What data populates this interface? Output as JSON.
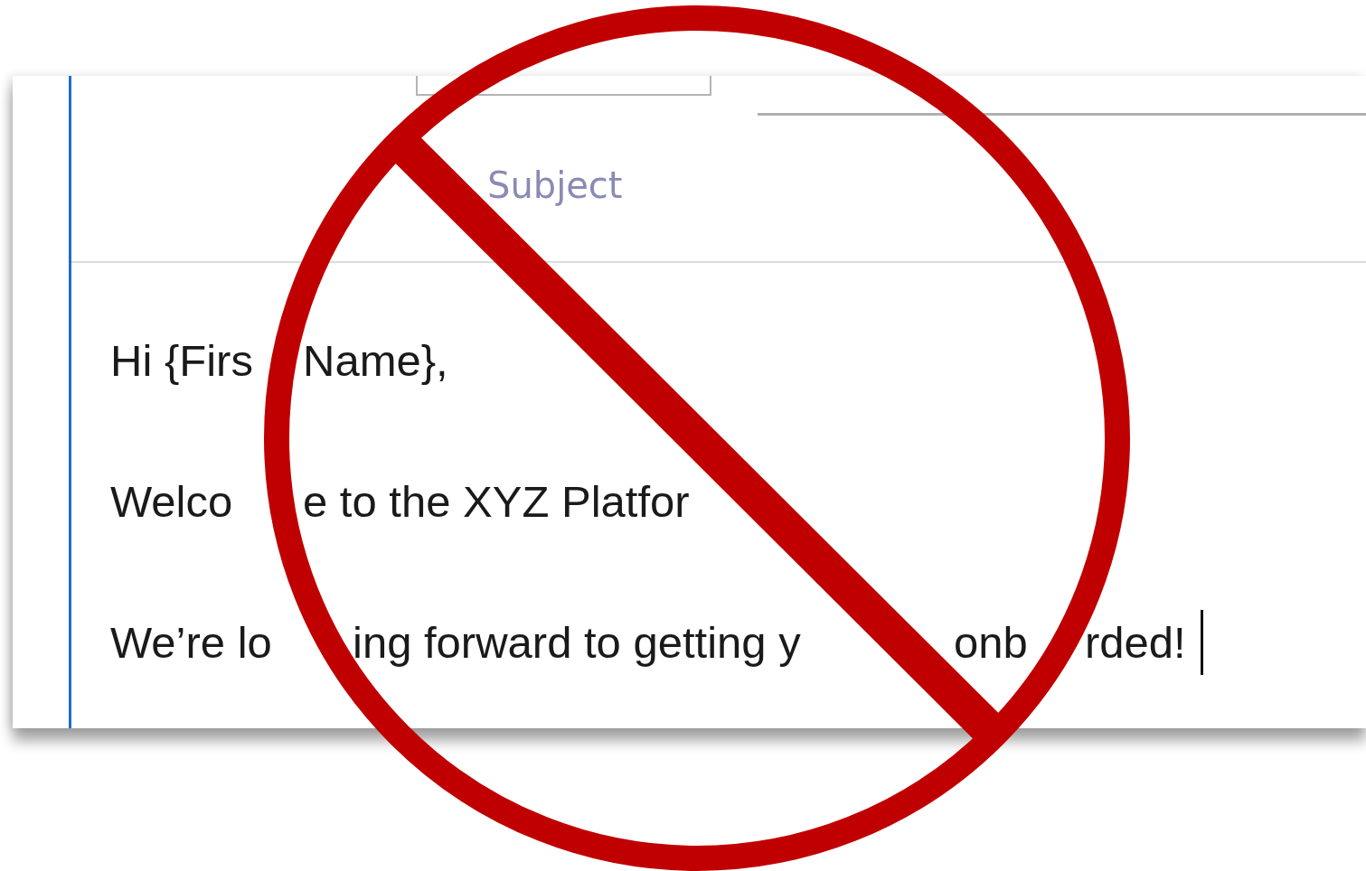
{
  "compose": {
    "subject": {
      "placeholder": "Subject"
    },
    "body": {
      "lines": [
        [
          "Hi {Firs",
          "Name},"
        ],
        [
          "Welco",
          "e to the XYZ Platfor"
        ],
        [
          "We’re lo",
          "ing forward to getting y",
          "onb",
          "rded!"
        ]
      ],
      "cursor_visible": true
    }
  }
}
